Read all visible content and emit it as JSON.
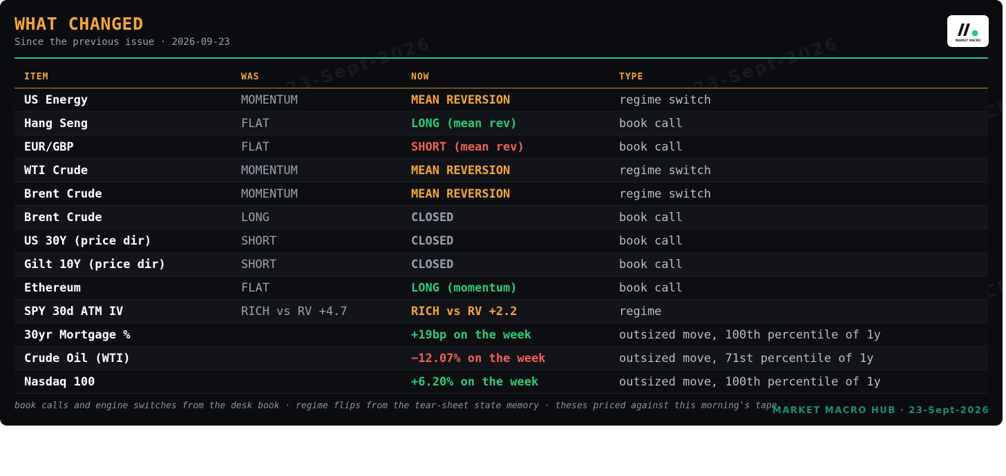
{
  "header": {
    "title": "WHAT CHANGED",
    "subtitle": "Since the previous issue · 2026-09-23",
    "logo_text": "MARKET MACRO"
  },
  "table": {
    "columns": [
      "ITEM",
      "WAS",
      "NOW",
      "TYPE"
    ],
    "rows": [
      {
        "item": "US Energy",
        "was": "MOMENTUM",
        "now": "MEAN REVERSION",
        "now_color": "#f5a53a",
        "type": "regime switch"
      },
      {
        "item": "Hang Seng",
        "was": "FLAT",
        "now": "LONG (mean rev)",
        "now_color": "#2ecb73",
        "type": "book call"
      },
      {
        "item": "EUR/GBP",
        "was": "FLAT",
        "now": "SHORT (mean rev)",
        "now_color": "#f0605b",
        "type": "book call"
      },
      {
        "item": "WTI Crude",
        "was": "MOMENTUM",
        "now": "MEAN REVERSION",
        "now_color": "#f5a53a",
        "type": "regime switch"
      },
      {
        "item": "Brent Crude",
        "was": "MOMENTUM",
        "now": "MEAN REVERSION",
        "now_color": "#f5a53a",
        "type": "regime switch"
      },
      {
        "item": "Brent Crude",
        "was": "LONG",
        "now": "CLOSED",
        "now_color": "#9aa2ad",
        "type": "book call"
      },
      {
        "item": "US 30Y (price dir)",
        "was": "SHORT",
        "now": "CLOSED",
        "now_color": "#9aa2ad",
        "type": "book call"
      },
      {
        "item": "Gilt 10Y (price dir)",
        "was": "SHORT",
        "now": "CLOSED",
        "now_color": "#9aa2ad",
        "type": "book call"
      },
      {
        "item": "Ethereum",
        "was": "FLAT",
        "now": "LONG (momentum)",
        "now_color": "#2ecb73",
        "type": "book call"
      },
      {
        "item": "SPY 30d ATM IV",
        "was": "RICH vs RV +4.7",
        "now": "RICH vs RV +2.2",
        "now_color": "#f5a53a",
        "type": "regime"
      },
      {
        "item": "30yr Mortgage %",
        "was": "",
        "now": "+19bp on the week",
        "now_color": "#2ecb73",
        "type": "outsized move, 100th percentile of 1y"
      },
      {
        "item": "Crude Oil (WTI)",
        "was": "",
        "now": "−12.07% on the week",
        "now_color": "#f0605b",
        "type": "outsized move, 71st percentile of 1y"
      },
      {
        "item": "Nasdaq 100",
        "was": "",
        "now": "+6.20% on the week",
        "now_color": "#2ecb73",
        "type": "outsized move, 100th percentile of 1y"
      }
    ]
  },
  "footer": {
    "note": "book calls and engine switches from the desk book · regime flips from the tear-sheet state memory · theses priced against this morning's tape",
    "brand": "MARKET MACRO HUB · 23-Sept-2026"
  },
  "watermark": {
    "texts": [
      "MARKET MACRO HUB · 23-Sept-2026"
    ]
  },
  "colors": {
    "background": "#0b0c0f",
    "accent_amber": "#f5a53a",
    "accent_teal": "#22c59a",
    "positive": "#2ecb73",
    "negative": "#f0605b",
    "neutral": "#9aa2ad"
  }
}
